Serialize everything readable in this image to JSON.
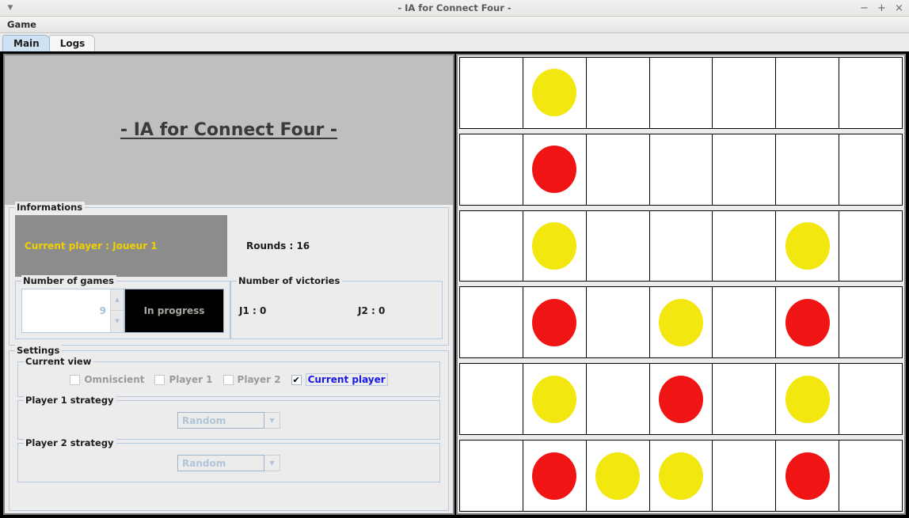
{
  "window": {
    "title": "- IA for Connect Four -",
    "menu_arrow_icon": "caret-down-icon",
    "minimize_label": "−",
    "maximize_label": "+",
    "close_label": "×"
  },
  "menubar": {
    "items": [
      {
        "label": "Game"
      }
    ]
  },
  "tabs": [
    {
      "label": "Main",
      "active": true
    },
    {
      "label": "Logs",
      "active": false
    }
  ],
  "banner": {
    "title": "- IA for Connect Four -"
  },
  "informations": {
    "legend": "Informations",
    "current_player": "Current player : Joueur 1",
    "current_player_color": "#f0d000",
    "rounds": "Rounds : 16"
  },
  "number_of_games": {
    "legend": "Number of games",
    "spinner_value": "9",
    "spin_up_icon": "caret-up-icon",
    "spin_down_icon": "caret-down-icon",
    "button_label": "In progress"
  },
  "number_of_victories": {
    "legend": "Number of victories",
    "j1": "J1 : 0",
    "j2": "J2 : 0"
  },
  "settings": {
    "legend": "Settings",
    "current_view": {
      "legend": "Current view",
      "options": [
        {
          "label": "Omniscient",
          "checked": false,
          "enabled": false
        },
        {
          "label": "Player 1",
          "checked": false,
          "enabled": false
        },
        {
          "label": "Player 2",
          "checked": false,
          "enabled": false
        },
        {
          "label": "Current player",
          "checked": true,
          "enabled": true
        }
      ],
      "check_glyph": "✔"
    },
    "player1_strategy": {
      "legend": "Player 1 strategy",
      "value": "Random",
      "arrow_icon": "chevron-down-icon"
    },
    "player2_strategy": {
      "legend": "Player 2 strategy",
      "value": "Random",
      "arrow_icon": "chevron-down-icon"
    }
  },
  "board": {
    "rows": 6,
    "cols": 7,
    "colors": {
      "yellow": "#f2e70e",
      "red": "#f01414",
      "empty": "#ffffff"
    },
    "grid": [
      [
        "empty",
        "yellow",
        "empty",
        "empty",
        "empty",
        "empty",
        "empty"
      ],
      [
        "empty",
        "red",
        "empty",
        "empty",
        "empty",
        "empty",
        "empty"
      ],
      [
        "empty",
        "yellow",
        "empty",
        "empty",
        "empty",
        "yellow",
        "empty"
      ],
      [
        "empty",
        "red",
        "empty",
        "yellow",
        "empty",
        "red",
        "empty"
      ],
      [
        "empty",
        "yellow",
        "empty",
        "red",
        "empty",
        "yellow",
        "empty"
      ],
      [
        "empty",
        "red",
        "yellow",
        "yellow",
        "empty",
        "red",
        "empty"
      ]
    ]
  }
}
